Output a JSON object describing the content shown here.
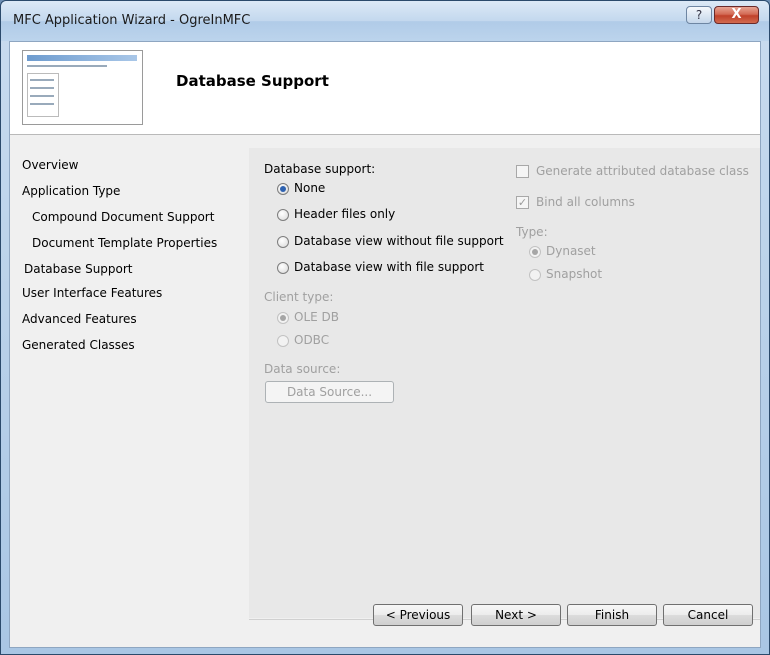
{
  "window": {
    "title": "MFC Application Wizard - OgreInMFC",
    "help_label": "?",
    "close_label": "X"
  },
  "header": {
    "title": "Database Support"
  },
  "nav": {
    "items": [
      {
        "label": "Overview"
      },
      {
        "label": "Application Type"
      },
      {
        "label": "Compound Document Support"
      },
      {
        "label": "Document Template Properties"
      },
      {
        "label": "Database Support"
      },
      {
        "label": "User Interface Features"
      },
      {
        "label": "Advanced Features"
      },
      {
        "label": "Generated Classes"
      }
    ]
  },
  "database_support": {
    "label": "Database support:",
    "options": [
      {
        "label": "None",
        "selected": true
      },
      {
        "label": "Header files only",
        "selected": false
      },
      {
        "label": "Database view without file support",
        "selected": false
      },
      {
        "label": "Database view with file support",
        "selected": false
      }
    ]
  },
  "client_type": {
    "label": "Client type:",
    "options": [
      {
        "label": "OLE DB",
        "selected": true
      },
      {
        "label": "ODBC",
        "selected": false
      }
    ]
  },
  "data_source": {
    "label": "Data source:",
    "button_label": "Data Source..."
  },
  "right_options": {
    "generate_label": "Generate attributed database class",
    "generate_checked": false,
    "bind_label": "Bind all columns",
    "bind_checked": true,
    "type_label": "Type:",
    "type_options": [
      {
        "label": "Dynaset",
        "selected": true
      },
      {
        "label": "Snapshot",
        "selected": false
      }
    ]
  },
  "footer": {
    "previous_label": "< Previous",
    "next_label": "Next >",
    "finish_label": "Finish",
    "cancel_label": "Cancel"
  },
  "colors": {
    "accent": "#2f62b0",
    "close_button": "#c0412a",
    "disabled_text": "#a0a0a0"
  }
}
